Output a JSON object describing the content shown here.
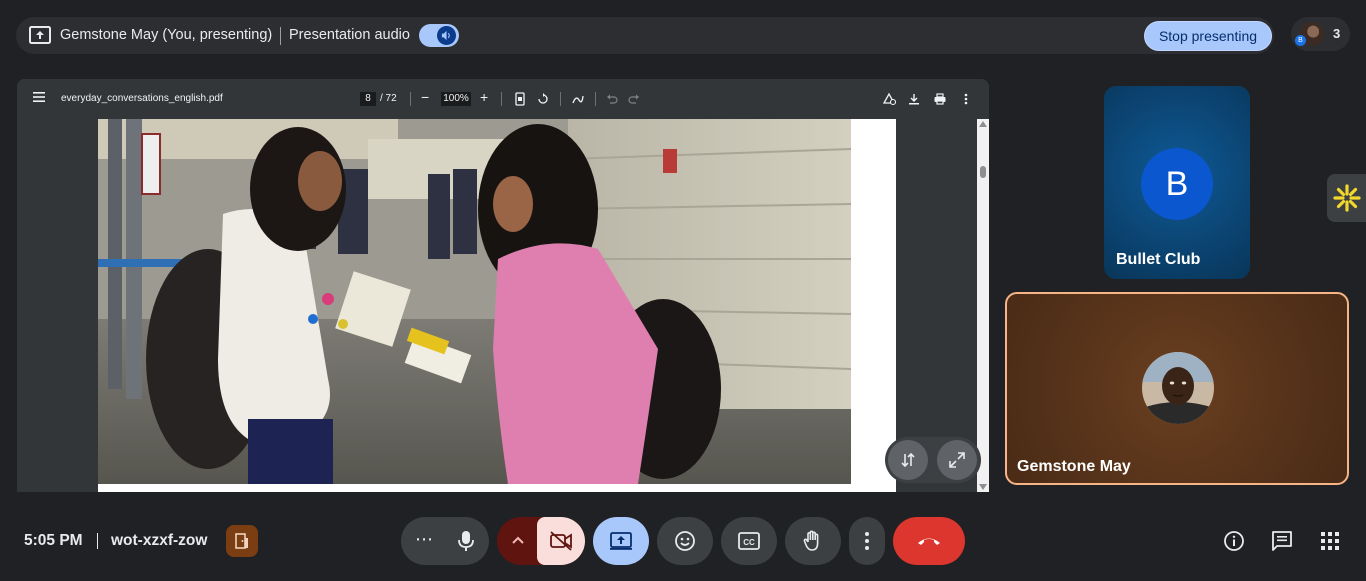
{
  "presenting_bar": {
    "presenter_text": "Gemstone May (You, presenting)",
    "audio_label": "Presentation audio",
    "audio_on": true,
    "stop_button": "Stop presenting"
  },
  "participants": {
    "count": "3",
    "mini_initial": "B"
  },
  "pdf_viewer": {
    "filename": "everyday_conversations_english.pdf",
    "current_page": "8",
    "total_pages": "/ 72",
    "zoom": "100%",
    "zoom_out": "−",
    "zoom_in": "+"
  },
  "tiles": [
    {
      "name": "Bullet Club",
      "initial": "B",
      "color": "#0b57d0"
    },
    {
      "name": "Gemstone May",
      "highlight_color": "#f7b486"
    }
  ],
  "bottom_bar": {
    "time": "5:05 PM",
    "meeting_code": "wot-xzxf-zow",
    "controls": {
      "more_options": "⋯",
      "mic": "mic-icon",
      "camera": "camera-off-icon",
      "present": "present-icon",
      "reactions": "emoji-icon",
      "captions": "captions-icon",
      "raise_hand": "hand-icon",
      "more": "more-vert-icon",
      "leave": "end-call-icon"
    },
    "right": [
      "info-icon",
      "chat-icon",
      "apps-icon"
    ]
  },
  "colors": {
    "background": "#202124",
    "accent": "#a8c7fa",
    "leave": "#dc362e",
    "camera_off_bg": "#f9dedc",
    "camera_caret_bg": "#601410"
  }
}
